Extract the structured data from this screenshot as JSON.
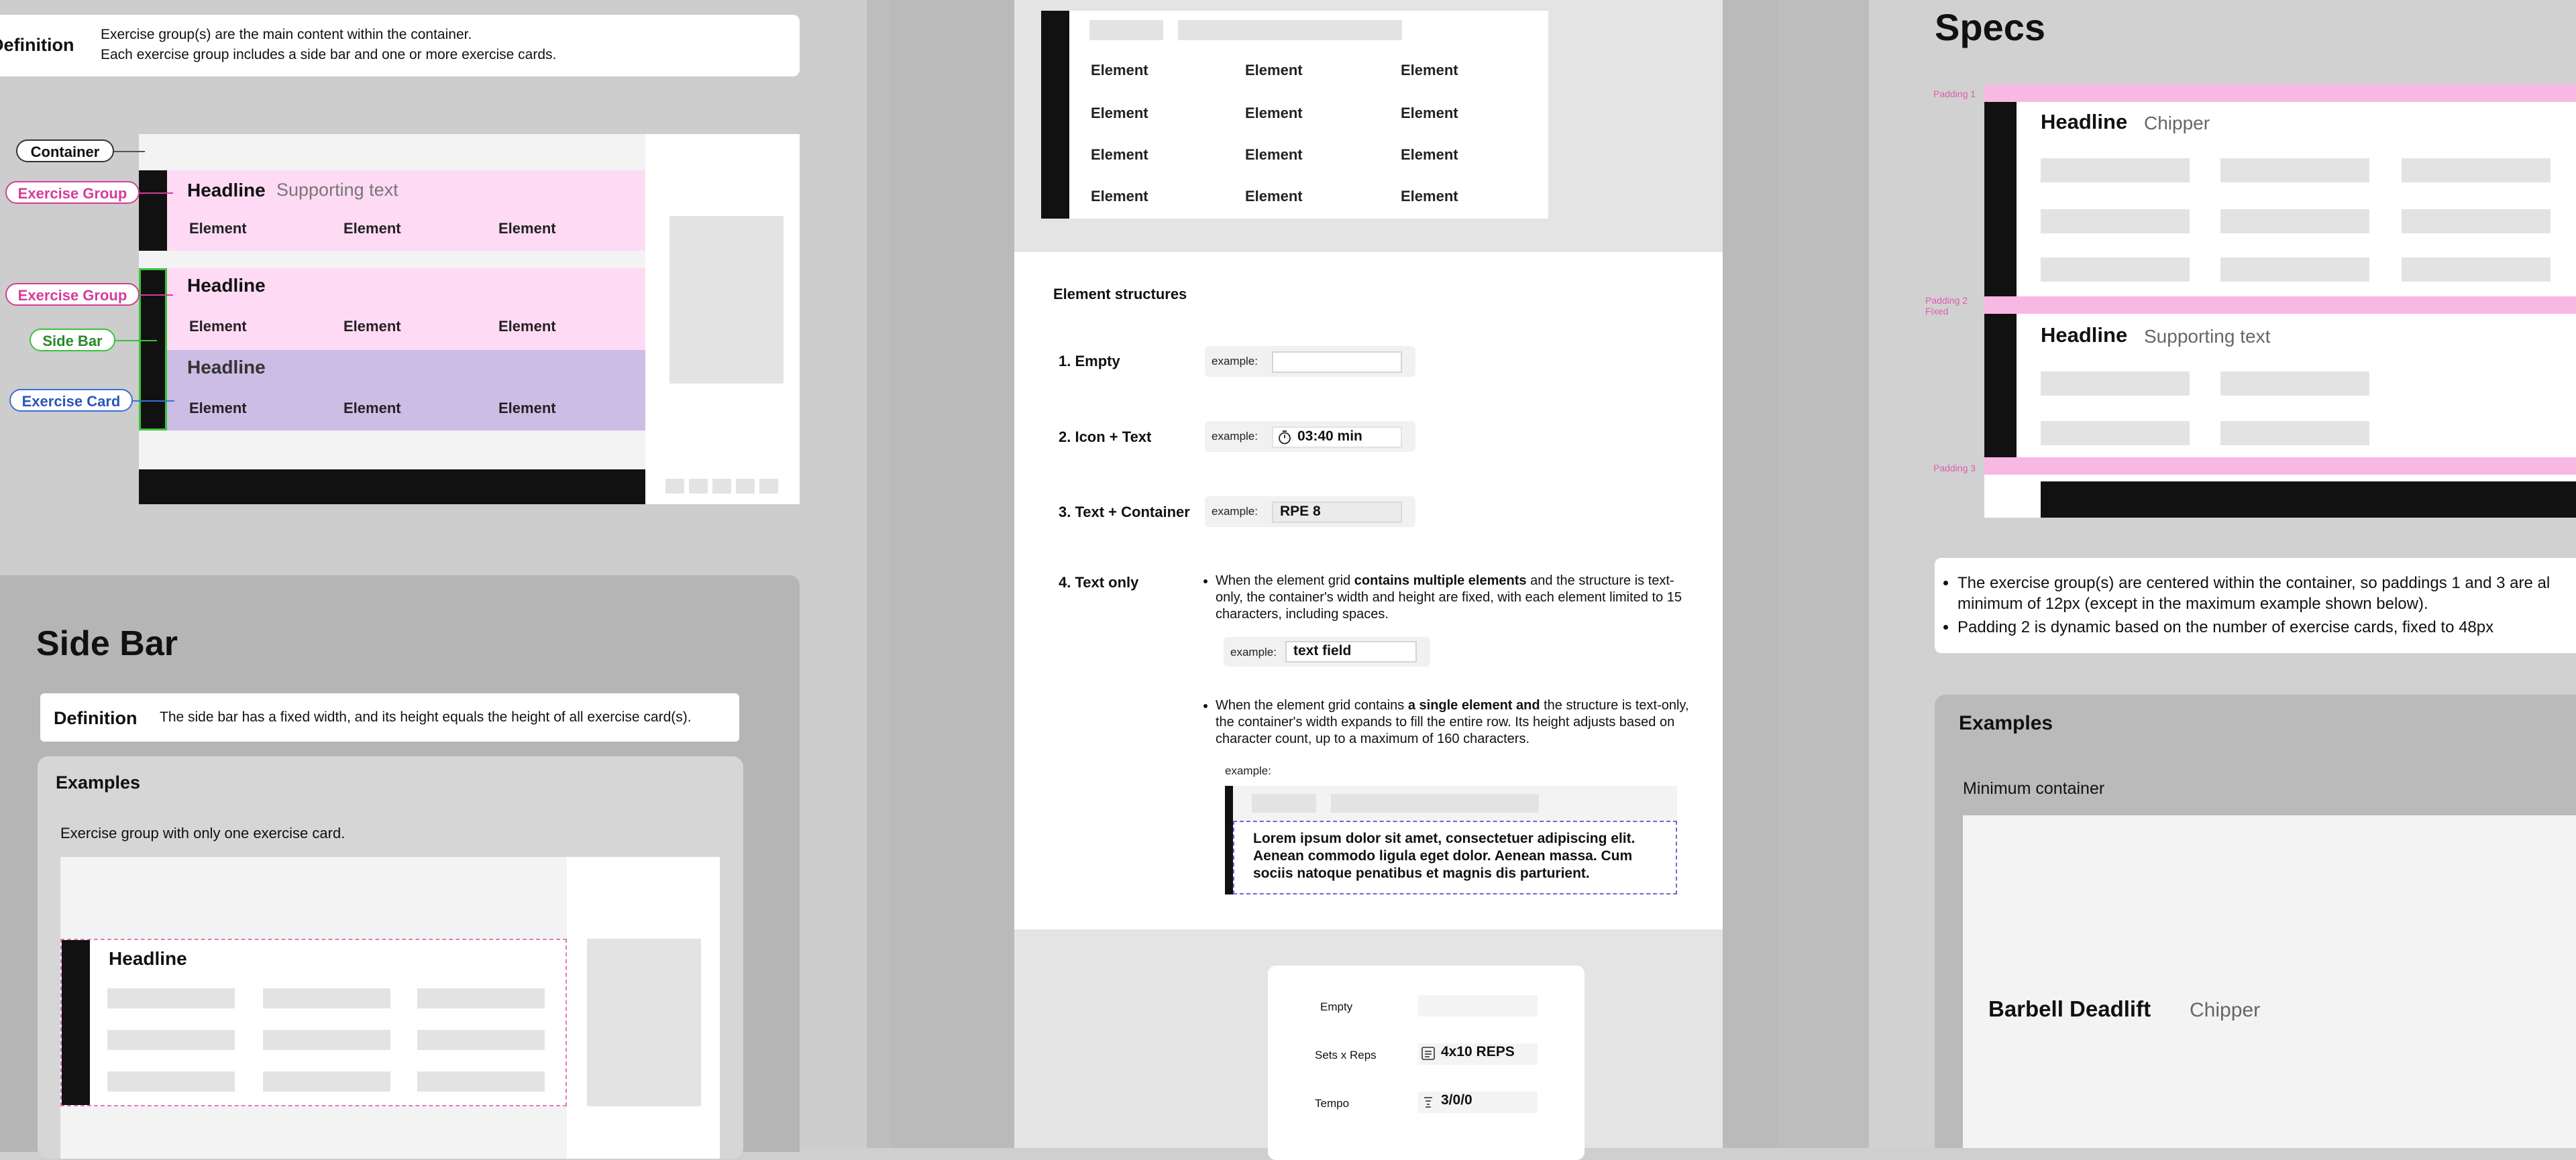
{
  "colors": {
    "pink": "#ffdaf4",
    "purple": "#cbbde4",
    "green": "#3ac43a",
    "magenta": "#d63c9b",
    "blue": "#3a6fd8",
    "pink_pad": "#f7b9e3"
  },
  "left": {
    "definition": {
      "label": "Definition",
      "line1": "Exercise group(s) are the main content within the container.",
      "line2": "Each exercise group includes a side bar and one or more exercise cards."
    },
    "annotations": {
      "container": "Container",
      "exercise_group_1": "Exercise Group",
      "exercise_group_2": "Exercise Group",
      "side_bar": "Side Bar",
      "exercise_card": "Exercise Card"
    },
    "group1": {
      "headline": "Headline",
      "supporting": "Supporting text",
      "elements": [
        "Element",
        "Element",
        "Element"
      ]
    },
    "group2a": {
      "headline": "Headline",
      "elements": [
        "Element",
        "Element",
        "Element"
      ]
    },
    "group2b": {
      "headline": "Headline",
      "elements": [
        "Element",
        "Element",
        "Element"
      ]
    },
    "sidebar_section": {
      "title": "Side Bar",
      "def_label": "Definition",
      "def_text": "The side bar has a fixed width, and its height equals the height of all exercise card(s).",
      "examples_title": "Examples",
      "example1_caption": "Exercise group with only one exercise card.",
      "example1_headline": "Headline"
    }
  },
  "middle": {
    "top_grid": {
      "rows": [
        [
          "Element",
          "Element",
          "Element"
        ],
        [
          "Element",
          "Element",
          "Element"
        ],
        [
          "Element",
          "Element",
          "Element"
        ],
        [
          "Element",
          "Element",
          "Element"
        ]
      ]
    },
    "structures_title": "Element structures",
    "example_label": "example:",
    "items": [
      {
        "label": "1. Empty",
        "value": ""
      },
      {
        "label": "2. Icon + Text",
        "value": "03:40 min",
        "icon": "stopwatch-icon"
      },
      {
        "label": "3. Text + Container",
        "value": "RPE 8"
      }
    ],
    "text_only": {
      "label": "4. Text only",
      "bullet1_a": "When the element grid ",
      "bullet1_b": "contains multiple elements",
      "bullet1_c": " and the structure is text-only, the container's width and height are fixed, with each element limited to 15 characters, including spaces.",
      "example1_value": "text field",
      "bullet2_a": "When the element grid contains ",
      "bullet2_b": "a single element and",
      "bullet2_c": " the structure is text-only, the container's width expands to fill the entire row. Its height adjusts based on character count, up to a maximum of 160 characters.",
      "lorem": "Lorem ipsum dolor sit amet, consectetuer adipiscing elit. Aenean commodo ligula eget dolor. Aenean massa. Cum sociis natoque penatibus et magnis dis parturient."
    },
    "card": {
      "rows": [
        {
          "label": "Empty",
          "value": ""
        },
        {
          "label": "Sets x Reps",
          "value": "4x10 REPS",
          "icon": "list-icon"
        },
        {
          "label": "Tempo",
          "value": "3/0/0",
          "icon": "tempo-icon"
        }
      ]
    }
  },
  "right": {
    "title": "Specs",
    "padding1": "Padding 1",
    "padding2a": "Padding 2",
    "padding2b": "Fixed",
    "padding3": "Padding 3",
    "group1": {
      "headline": "Headline",
      "supporting": "Chipper"
    },
    "group2": {
      "headline": "Headline",
      "supporting": "Supporting text"
    },
    "bullets": [
      "The exercise group(s) are centered within the container, so paddings 1 and 3 are al",
      "minimum of 12px (except in the maximum example shown below).",
      "Padding 2 is dynamic based on the number of exercise cards, fixed to 48px"
    ],
    "examples_title": "Examples",
    "min_container": "Minimum container",
    "example_headline": "Barbell Deadlift",
    "example_supporting": "Chipper"
  }
}
